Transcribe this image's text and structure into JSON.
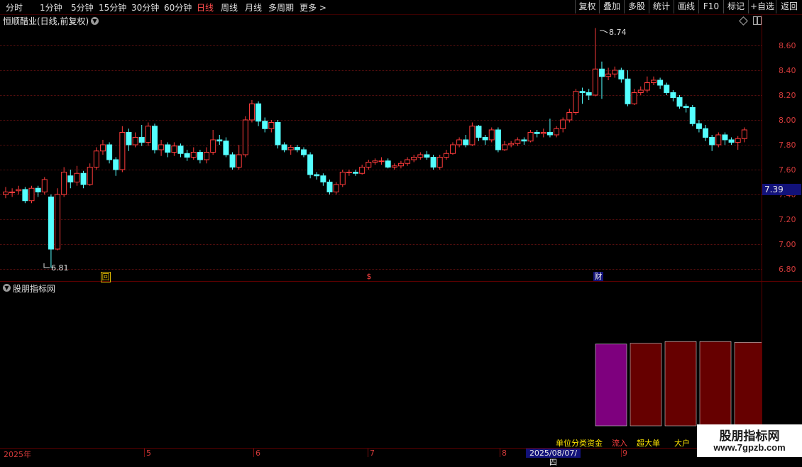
{
  "toolbar": {
    "periods": [
      "分时",
      "1分钟",
      "5分钟",
      "15分钟",
      "30分钟",
      "60分钟",
      "日线",
      "周线",
      "月线",
      "多周期",
      "更多 >"
    ],
    "active_period": "日线",
    "tools": [
      "复权",
      "叠加",
      "多股",
      "统计",
      "画线",
      "F10",
      "标记",
      "+自选",
      "返回"
    ]
  },
  "chart_title": "恒顺醋业(日线,前复权)",
  "price_axis": [
    "8.60",
    "8.40",
    "8.20",
    "8.00",
    "7.80",
    "7.60",
    "7.40",
    "7.20",
    "7.00",
    "6.80"
  ],
  "current_price": "7.39",
  "annotations": {
    "high": "8.74",
    "low": "6.81"
  },
  "markers": [
    "回",
    "$",
    "财"
  ],
  "indicator_title": "股朋指标网",
  "indicator_legend": [
    "单位分类资金",
    "流入",
    "超大单",
    "大户"
  ],
  "date_axis": [
    "2025年",
    "5",
    "6",
    "7",
    "8",
    "9"
  ],
  "date_cursor": "2025/08/07/四",
  "watermark": {
    "name": "股朋指标网",
    "url": "www.7gpzb.com"
  },
  "colors": {
    "up": "#ff3b3b",
    "down": "#54ffff",
    "grid": "#5a0f0f",
    "axis_text": "#d23a3a",
    "cursor_bg": "#12127a"
  },
  "chart_data": {
    "type": "candlestick",
    "y_range": [
      6.75,
      8.85
    ],
    "x_categories": [
      "2025年",
      "5",
      "6",
      "7",
      "8",
      "9"
    ],
    "extremes": {
      "high": 8.74,
      "low": 6.81
    },
    "current": 7.39,
    "candles": [
      [
        7.4,
        7.42,
        7.46,
        7.37
      ],
      [
        7.42,
        7.42,
        7.45,
        7.38
      ],
      [
        7.43,
        7.44,
        7.47,
        7.4
      ],
      [
        7.44,
        7.35,
        7.46,
        7.33
      ],
      [
        7.35,
        7.45,
        7.47,
        7.33
      ],
      [
        7.45,
        7.42,
        7.47,
        7.38
      ],
      [
        7.42,
        7.52,
        7.54,
        7.4
      ],
      [
        7.38,
        6.96,
        7.4,
        6.81
      ],
      [
        6.96,
        7.4,
        7.45,
        6.95
      ],
      [
        7.4,
        7.58,
        7.62,
        7.38
      ],
      [
        7.55,
        7.5,
        7.6,
        7.45
      ],
      [
        7.5,
        7.57,
        7.63,
        7.47
      ],
      [
        7.57,
        7.48,
        7.59,
        7.45
      ],
      [
        7.48,
        7.62,
        7.65,
        7.47
      ],
      [
        7.62,
        7.75,
        7.78,
        7.6
      ],
      [
        7.75,
        7.8,
        7.84,
        7.72
      ],
      [
        7.8,
        7.68,
        7.82,
        7.65
      ],
      [
        7.68,
        7.6,
        7.7,
        7.55
      ],
      [
        7.6,
        7.9,
        7.95,
        7.58
      ],
      [
        7.9,
        7.8,
        7.93,
        7.75
      ],
      [
        7.8,
        7.86,
        7.9,
        7.78
      ],
      [
        7.86,
        7.82,
        7.96,
        7.79
      ],
      [
        7.82,
        7.95,
        7.98,
        7.79
      ],
      [
        7.95,
        7.76,
        7.97,
        7.73
      ],
      [
        7.76,
        7.8,
        7.84,
        7.71
      ],
      [
        7.8,
        7.74,
        7.82,
        7.7
      ],
      [
        7.74,
        7.79,
        7.82,
        7.71
      ],
      [
        7.79,
        7.73,
        7.81,
        7.7
      ],
      [
        7.73,
        7.7,
        7.76,
        7.67
      ],
      [
        7.7,
        7.74,
        7.78,
        7.68
      ],
      [
        7.74,
        7.68,
        7.76,
        7.65
      ],
      [
        7.68,
        7.74,
        7.78,
        7.65
      ],
      [
        7.74,
        7.84,
        7.92,
        7.72
      ],
      [
        7.84,
        7.83,
        7.88,
        7.8
      ],
      [
        7.83,
        7.72,
        7.86,
        7.7
      ],
      [
        7.72,
        7.62,
        7.74,
        7.6
      ],
      [
        7.62,
        7.72,
        7.8,
        7.6
      ],
      [
        7.72,
        8.0,
        8.03,
        7.7
      ],
      [
        8.0,
        8.13,
        8.16,
        7.98
      ],
      [
        8.13,
        7.99,
        8.15,
        7.95
      ],
      [
        7.99,
        7.93,
        8.02,
        7.9
      ],
      [
        7.93,
        7.98,
        8.0,
        7.9
      ],
      [
        7.98,
        7.8,
        8.0,
        7.77
      ],
      [
        7.8,
        7.76,
        7.82,
        7.74
      ],
      [
        7.76,
        7.78,
        7.8,
        7.72
      ],
      [
        7.78,
        7.76,
        7.8,
        7.74
      ],
      [
        7.76,
        7.72,
        7.78,
        7.7
      ],
      [
        7.72,
        7.56,
        7.74,
        7.53
      ],
      [
        7.56,
        7.55,
        7.58,
        7.52
      ],
      [
        7.55,
        7.5,
        7.57,
        7.47
      ],
      [
        7.5,
        7.42,
        7.52,
        7.4
      ],
      [
        7.42,
        7.48,
        7.5,
        7.4
      ],
      [
        7.48,
        7.58,
        7.6,
        7.46
      ],
      [
        7.58,
        7.58,
        7.6,
        7.55
      ],
      [
        7.58,
        7.57,
        7.6,
        7.55
      ],
      [
        7.57,
        7.62,
        7.64,
        7.56
      ],
      [
        7.62,
        7.66,
        7.68,
        7.6
      ],
      [
        7.66,
        7.67,
        7.69,
        7.64
      ],
      [
        7.67,
        7.67,
        7.7,
        7.64
      ],
      [
        7.67,
        7.62,
        7.69,
        7.61
      ],
      [
        7.62,
        7.63,
        7.65,
        7.6
      ],
      [
        7.63,
        7.65,
        7.67,
        7.61
      ],
      [
        7.65,
        7.68,
        7.7,
        7.63
      ],
      [
        7.68,
        7.7,
        7.72,
        7.66
      ],
      [
        7.7,
        7.72,
        7.74,
        7.68
      ],
      [
        7.72,
        7.7,
        7.75,
        7.68
      ],
      [
        7.7,
        7.62,
        7.72,
        7.6
      ],
      [
        7.62,
        7.7,
        7.72,
        7.6
      ],
      [
        7.7,
        7.73,
        7.76,
        7.68
      ],
      [
        7.73,
        7.8,
        7.82,
        7.72
      ],
      [
        7.8,
        7.84,
        7.86,
        7.78
      ],
      [
        7.84,
        7.8,
        7.88,
        7.78
      ],
      [
        7.8,
        7.95,
        7.98,
        7.79
      ],
      [
        7.95,
        7.86,
        7.96,
        7.83
      ],
      [
        7.86,
        7.84,
        7.88,
        7.8
      ],
      [
        7.84,
        7.92,
        7.94,
        7.82
      ],
      [
        7.92,
        7.76,
        7.94,
        7.74
      ],
      [
        7.76,
        7.8,
        7.83,
        7.75
      ],
      [
        7.8,
        7.81,
        7.83,
        7.78
      ],
      [
        7.81,
        7.84,
        7.86,
        7.79
      ],
      [
        7.84,
        7.83,
        7.86,
        7.8
      ],
      [
        7.83,
        7.9,
        7.92,
        7.82
      ],
      [
        7.9,
        7.89,
        7.92,
        7.86
      ],
      [
        7.89,
        7.9,
        7.93,
        7.86
      ],
      [
        7.9,
        7.88,
        8.01,
        7.86
      ],
      [
        7.88,
        7.93,
        7.95,
        7.86
      ],
      [
        7.93,
        8.0,
        8.02,
        7.9
      ],
      [
        8.0,
        8.06,
        8.09,
        7.98
      ],
      [
        8.06,
        8.23,
        8.25,
        8.04
      ],
      [
        8.23,
        8.22,
        8.26,
        8.13
      ],
      [
        8.22,
        8.2,
        8.25,
        8.16
      ],
      [
        8.2,
        8.41,
        8.74,
        8.19
      ],
      [
        8.41,
        8.35,
        8.47,
        8.17
      ],
      [
        8.35,
        8.37,
        8.42,
        8.32
      ],
      [
        8.37,
        8.4,
        8.43,
        8.34
      ],
      [
        8.4,
        8.33,
        8.42,
        8.3
      ],
      [
        8.33,
        8.13,
        8.4,
        8.11
      ],
      [
        8.13,
        8.22,
        8.25,
        8.12
      ],
      [
        8.22,
        8.24,
        8.27,
        8.2
      ],
      [
        8.24,
        8.3,
        8.35,
        8.22
      ],
      [
        8.3,
        8.32,
        8.35,
        8.28
      ],
      [
        8.32,
        8.28,
        8.34,
        8.25
      ],
      [
        8.28,
        8.22,
        8.3,
        8.2
      ],
      [
        8.22,
        8.18,
        8.24,
        8.15
      ],
      [
        8.18,
        8.11,
        8.2,
        8.09
      ],
      [
        8.11,
        8.1,
        8.13,
        8.06
      ],
      [
        8.1,
        7.97,
        8.12,
        7.95
      ],
      [
        7.97,
        7.93,
        8.0,
        7.9
      ],
      [
        7.93,
        7.86,
        7.96,
        7.83
      ],
      [
        7.86,
        7.8,
        7.88,
        7.75
      ],
      [
        7.8,
        7.88,
        7.9,
        7.78
      ],
      [
        7.88,
        7.84,
        7.9,
        7.8
      ],
      [
        7.84,
        7.82,
        7.86,
        7.8
      ],
      [
        7.82,
        7.85,
        7.87,
        7.76
      ],
      [
        7.85,
        7.92,
        7.94,
        7.82
      ]
    ],
    "indicator_bars": [
      {
        "name": "单位分类资金",
        "color": "#7e007e",
        "value": 0.96
      },
      {
        "name": "流入",
        "color": "#660000",
        "value": 0.97
      },
      {
        "name": "超大单",
        "color": "#660000",
        "value": 0.99
      },
      {
        "name": "大户",
        "color": "#660000",
        "value": 0.99
      },
      {
        "name": "",
        "color": "#660000",
        "value": 0.98
      }
    ]
  }
}
